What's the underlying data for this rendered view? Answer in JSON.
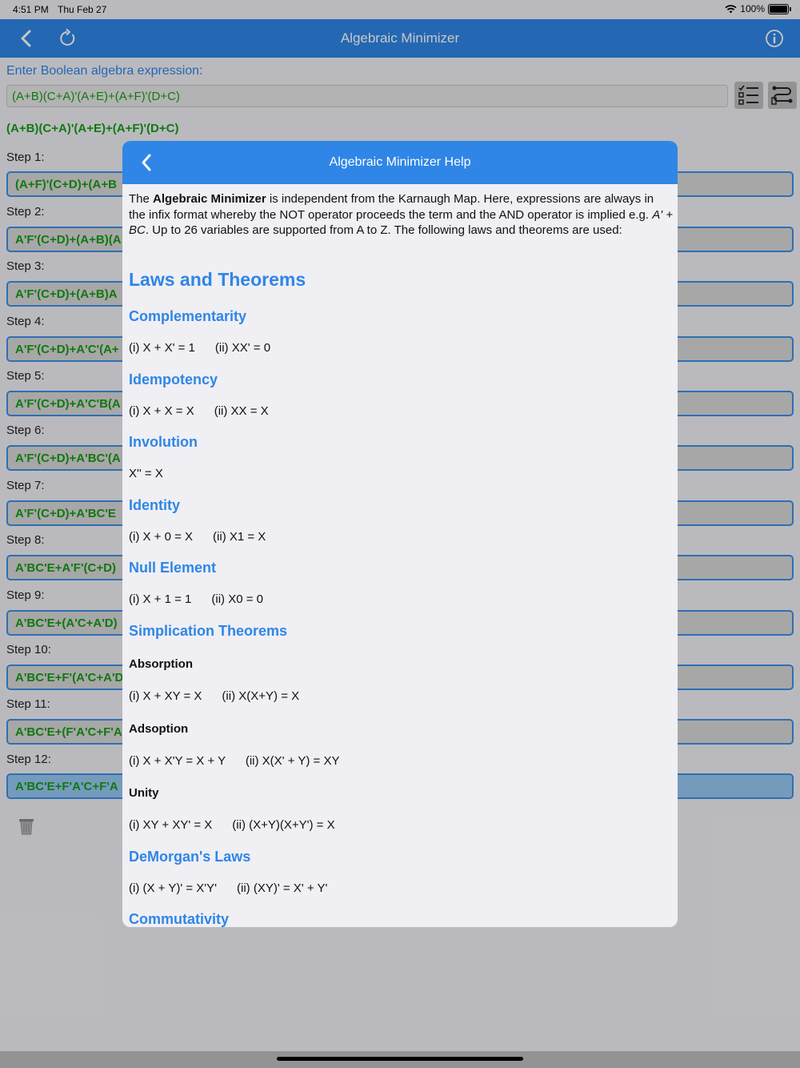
{
  "status": {
    "time": "4:51 PM",
    "date": "Thu Feb 27",
    "battery": "100%"
  },
  "nav": {
    "title": "Algebraic Minimizer"
  },
  "prompt": "Enter Boolean algebra expression:",
  "input_value": "(A+B)(C+A)'(A+E)+(A+F)'(D+C)",
  "current_expression": "(A+B)(C+A)'(A+E)+(A+F)'(D+C)",
  "steps": [
    {
      "label": "Step 1:",
      "value": "(A+F)'(C+D)+(A+B"
    },
    {
      "label": "Step 2:",
      "value": "A'F'(C+D)+(A+B)(A"
    },
    {
      "label": "Step 3:",
      "value": "A'F'(C+D)+(A+B)A"
    },
    {
      "label": "Step 4:",
      "value": "A'F'(C+D)+A'C'(A+"
    },
    {
      "label": "Step 5:",
      "value": "A'F'(C+D)+A'C'B(A"
    },
    {
      "label": "Step 6:",
      "value": "A'F'(C+D)+A'BC'(A"
    },
    {
      "label": "Step 7:",
      "value": "A'F'(C+D)+A'BC'E"
    },
    {
      "label": "Step 8:",
      "value": "A'BC'E+A'F'(C+D)"
    },
    {
      "label": "Step 9:",
      "value": "A'BC'E+(A'C+A'D)"
    },
    {
      "label": "Step 10:",
      "value": "A'BC'E+F'(A'C+A'D"
    },
    {
      "label": "Step 11:",
      "value": "A'BC'E+(F'A'C+F'A"
    },
    {
      "label": "Step 12:",
      "value": "A'BC'E+F'A'C+F'A"
    }
  ],
  "help": {
    "title": "Algebraic Minimizer Help",
    "intro_1": "The ",
    "intro_bold": "Algebraic Minimizer",
    "intro_2": " is independent from the Karnaugh Map. Here, expressions are always in the infix format whereby the NOT operator proceeds the term and the AND operator is implied e.g. ",
    "intro_example": "A' + BC",
    "intro_3": ". Up to 26 variables are supported from A to Z. The following laws and theorems are used:",
    "heading": "Laws and Theorems",
    "sections": {
      "complementarity": {
        "title": "Complementarity",
        "text": "(i) X + X' = 1      (ii) XX' = 0"
      },
      "idempotency": {
        "title": "Idempotency",
        "text": "(i) X + X = X      (ii) XX = X"
      },
      "involution": {
        "title": "Involution",
        "text": "X'' = X"
      },
      "identity": {
        "title": "Identity",
        "text": "(i) X + 0 = X      (ii) X1 = X"
      },
      "null_element": {
        "title": "Null Element",
        "text": "(i) X + 1 = 1      (ii) X0 = 0"
      },
      "simplification": {
        "title": "Simplication Theorems"
      },
      "absorption": {
        "title": "Absorption",
        "text": "(i) X + XY = X      (ii) X(X+Y) = X"
      },
      "adsoption": {
        "title": "Adsoption",
        "text": "(i) X + X'Y = X + Y      (ii) X(X' + Y) = XY"
      },
      "unity": {
        "title": "Unity",
        "text": "(i) XY + XY' = X      (ii) (X+Y)(X+Y') = X"
      },
      "demorgan": {
        "title": "DeMorgan's Laws",
        "text": "(i) (X + Y)' = X'Y'      (ii) (XY)' = X' + Y'"
      },
      "commutativity": {
        "title": "Commutativity"
      }
    }
  }
}
